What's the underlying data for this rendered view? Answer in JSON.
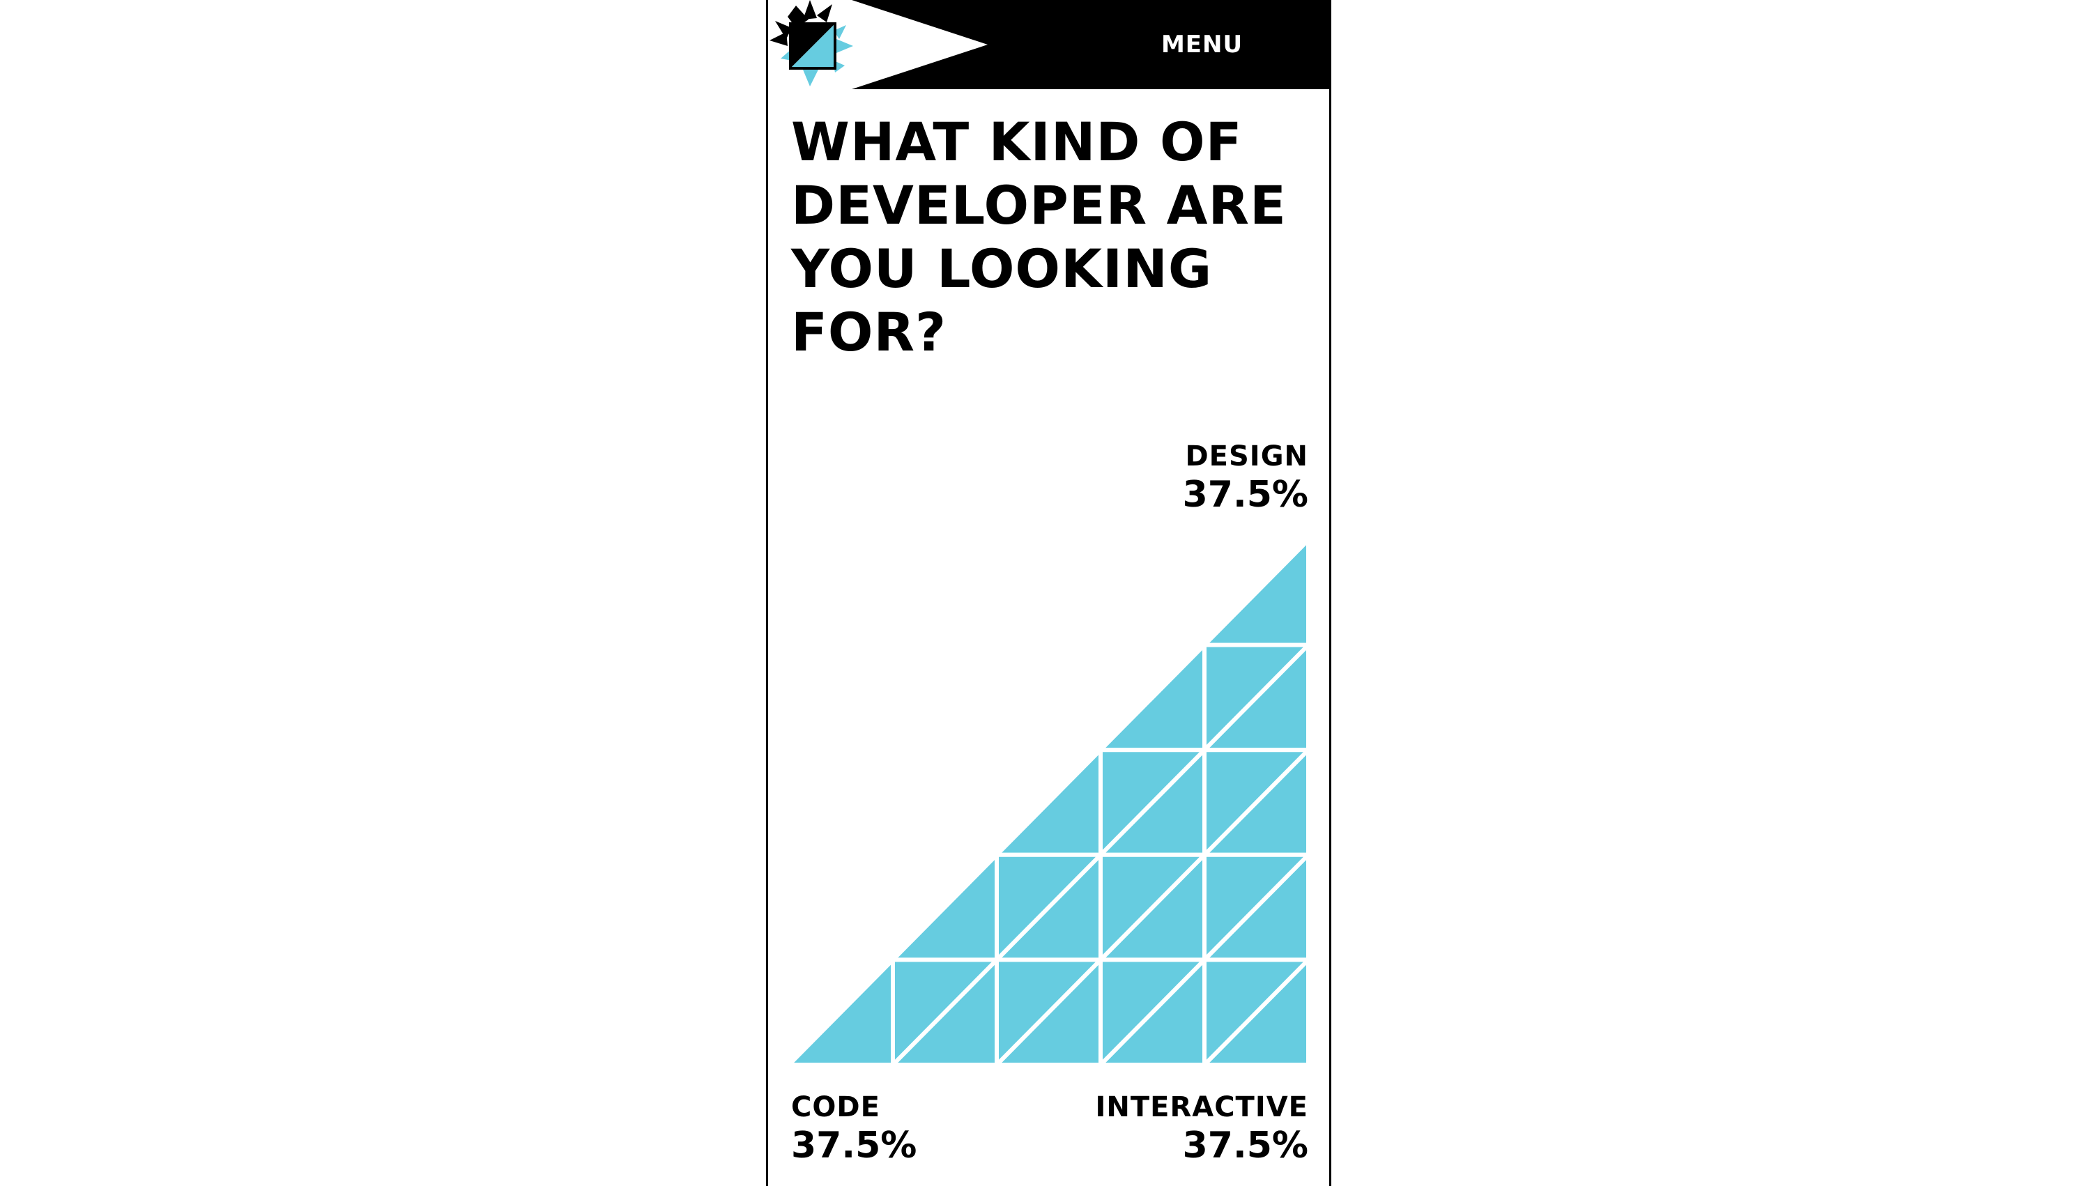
{
  "header": {
    "menu_label": "MENU"
  },
  "page": {
    "title": "WHAT KIND OF DEVELOPER ARE YOU LOOKING FOR?"
  },
  "colors": {
    "accent": "#66cce0",
    "ink": "#000000",
    "paper": "#ffffff"
  },
  "icons": {
    "logo": "starburst-logo-icon"
  },
  "chart_data": {
    "type": "ternary",
    "grid_divisions": 5,
    "vertices": [
      {
        "name": "DESIGN",
        "value": "37.5%"
      },
      {
        "name": "CODE",
        "value": "37.5%"
      },
      {
        "name": "INTERACTIVE",
        "value": "37.5%"
      }
    ]
  }
}
